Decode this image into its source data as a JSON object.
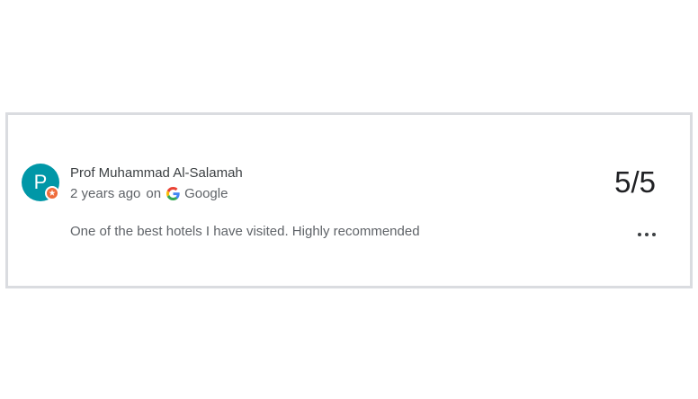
{
  "review": {
    "avatar_letter": "P",
    "reviewer_name": "Prof Muhammad Al-Salamah",
    "time_ago": "2 years ago",
    "on_text": "on",
    "source": "Google",
    "rating": "5/5",
    "text": "One of the best hotels I have visited. Highly recommended"
  },
  "icons": {
    "badge": "local-guide-badge-icon",
    "source": "google-logo-icon",
    "more": "more-options-icon"
  },
  "colors": {
    "avatar": "#0097a7",
    "badge": "#ef6c3b",
    "border": "#dadce0"
  }
}
